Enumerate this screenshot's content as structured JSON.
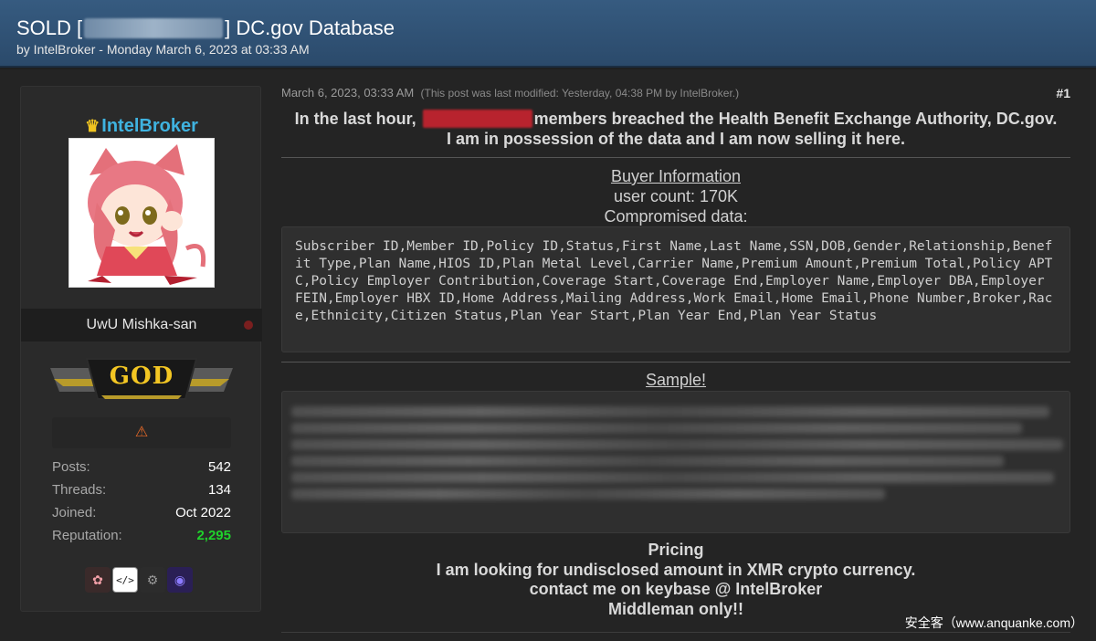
{
  "thread": {
    "title_prefix": "SOLD [",
    "title_suffix": "] DC.gov Database",
    "meta": "by IntelBroker - Monday March 6, 2023 at 03:33 AM"
  },
  "user": {
    "name": "IntelBroker",
    "title": "UwU Mishka-san",
    "rank": "GOD",
    "stats": [
      {
        "label": "Posts:",
        "value": "542"
      },
      {
        "label": "Threads:",
        "value": "134"
      },
      {
        "label": "Joined:",
        "value": "Oct 2022"
      },
      {
        "label": "Reputation:",
        "value": "2,295"
      }
    ],
    "award_icons": [
      "brain-icon",
      "code-icon",
      "gear-icon",
      "hood-icon"
    ]
  },
  "post": {
    "date": "March 6, 2023, 03:33 AM",
    "modified": "(This post was last modified: Yesterday, 04:38 PM by IntelBroker.)",
    "number": "#1",
    "lead_before": "In the last hour,",
    "lead_after": "members breached the Health Benefit Exchange Authority, DC.gov.",
    "lead_line2": "I am in possession of the data and I am now selling it here.",
    "buyer_heading": "Buyer Information",
    "user_count": "user count: 170K",
    "compromised": "Compromised data:",
    "fields": "Subscriber ID,Member ID,Policy ID,Status,First Name,Last Name,SSN,DOB,Gender,Relationship,Benefit Type,Plan Name,HIOS ID,Plan Metal Level,Carrier Name,Premium Amount,Premium Total,Policy APTC,Policy Employer Contribution,Coverage Start,Coverage End,Employer Name,Employer DBA,Employer FEIN,Employer HBX ID,Home Address,Mailing Address,Work Email,Home Email,Phone Number,Broker,Race,Ethnicity,Citizen Status,Plan Year Start,Plan Year End,Plan Year Status",
    "sample_heading": "Sample!",
    "pricing_heading": "Pricing",
    "pricing_line1": "I am looking for undisclosed amount in XMR crypto currency.",
    "pricing_line2": "contact me on keybase @ IntelBroker",
    "pricing_line3": "Middleman only!!"
  },
  "watermark": "安全客（www.anquanke.com）",
  "colors": {
    "header_bg": "#2f5275",
    "username": "#3fb3e0",
    "reputation": "#1fd12b",
    "redaction": "#b8232e"
  }
}
